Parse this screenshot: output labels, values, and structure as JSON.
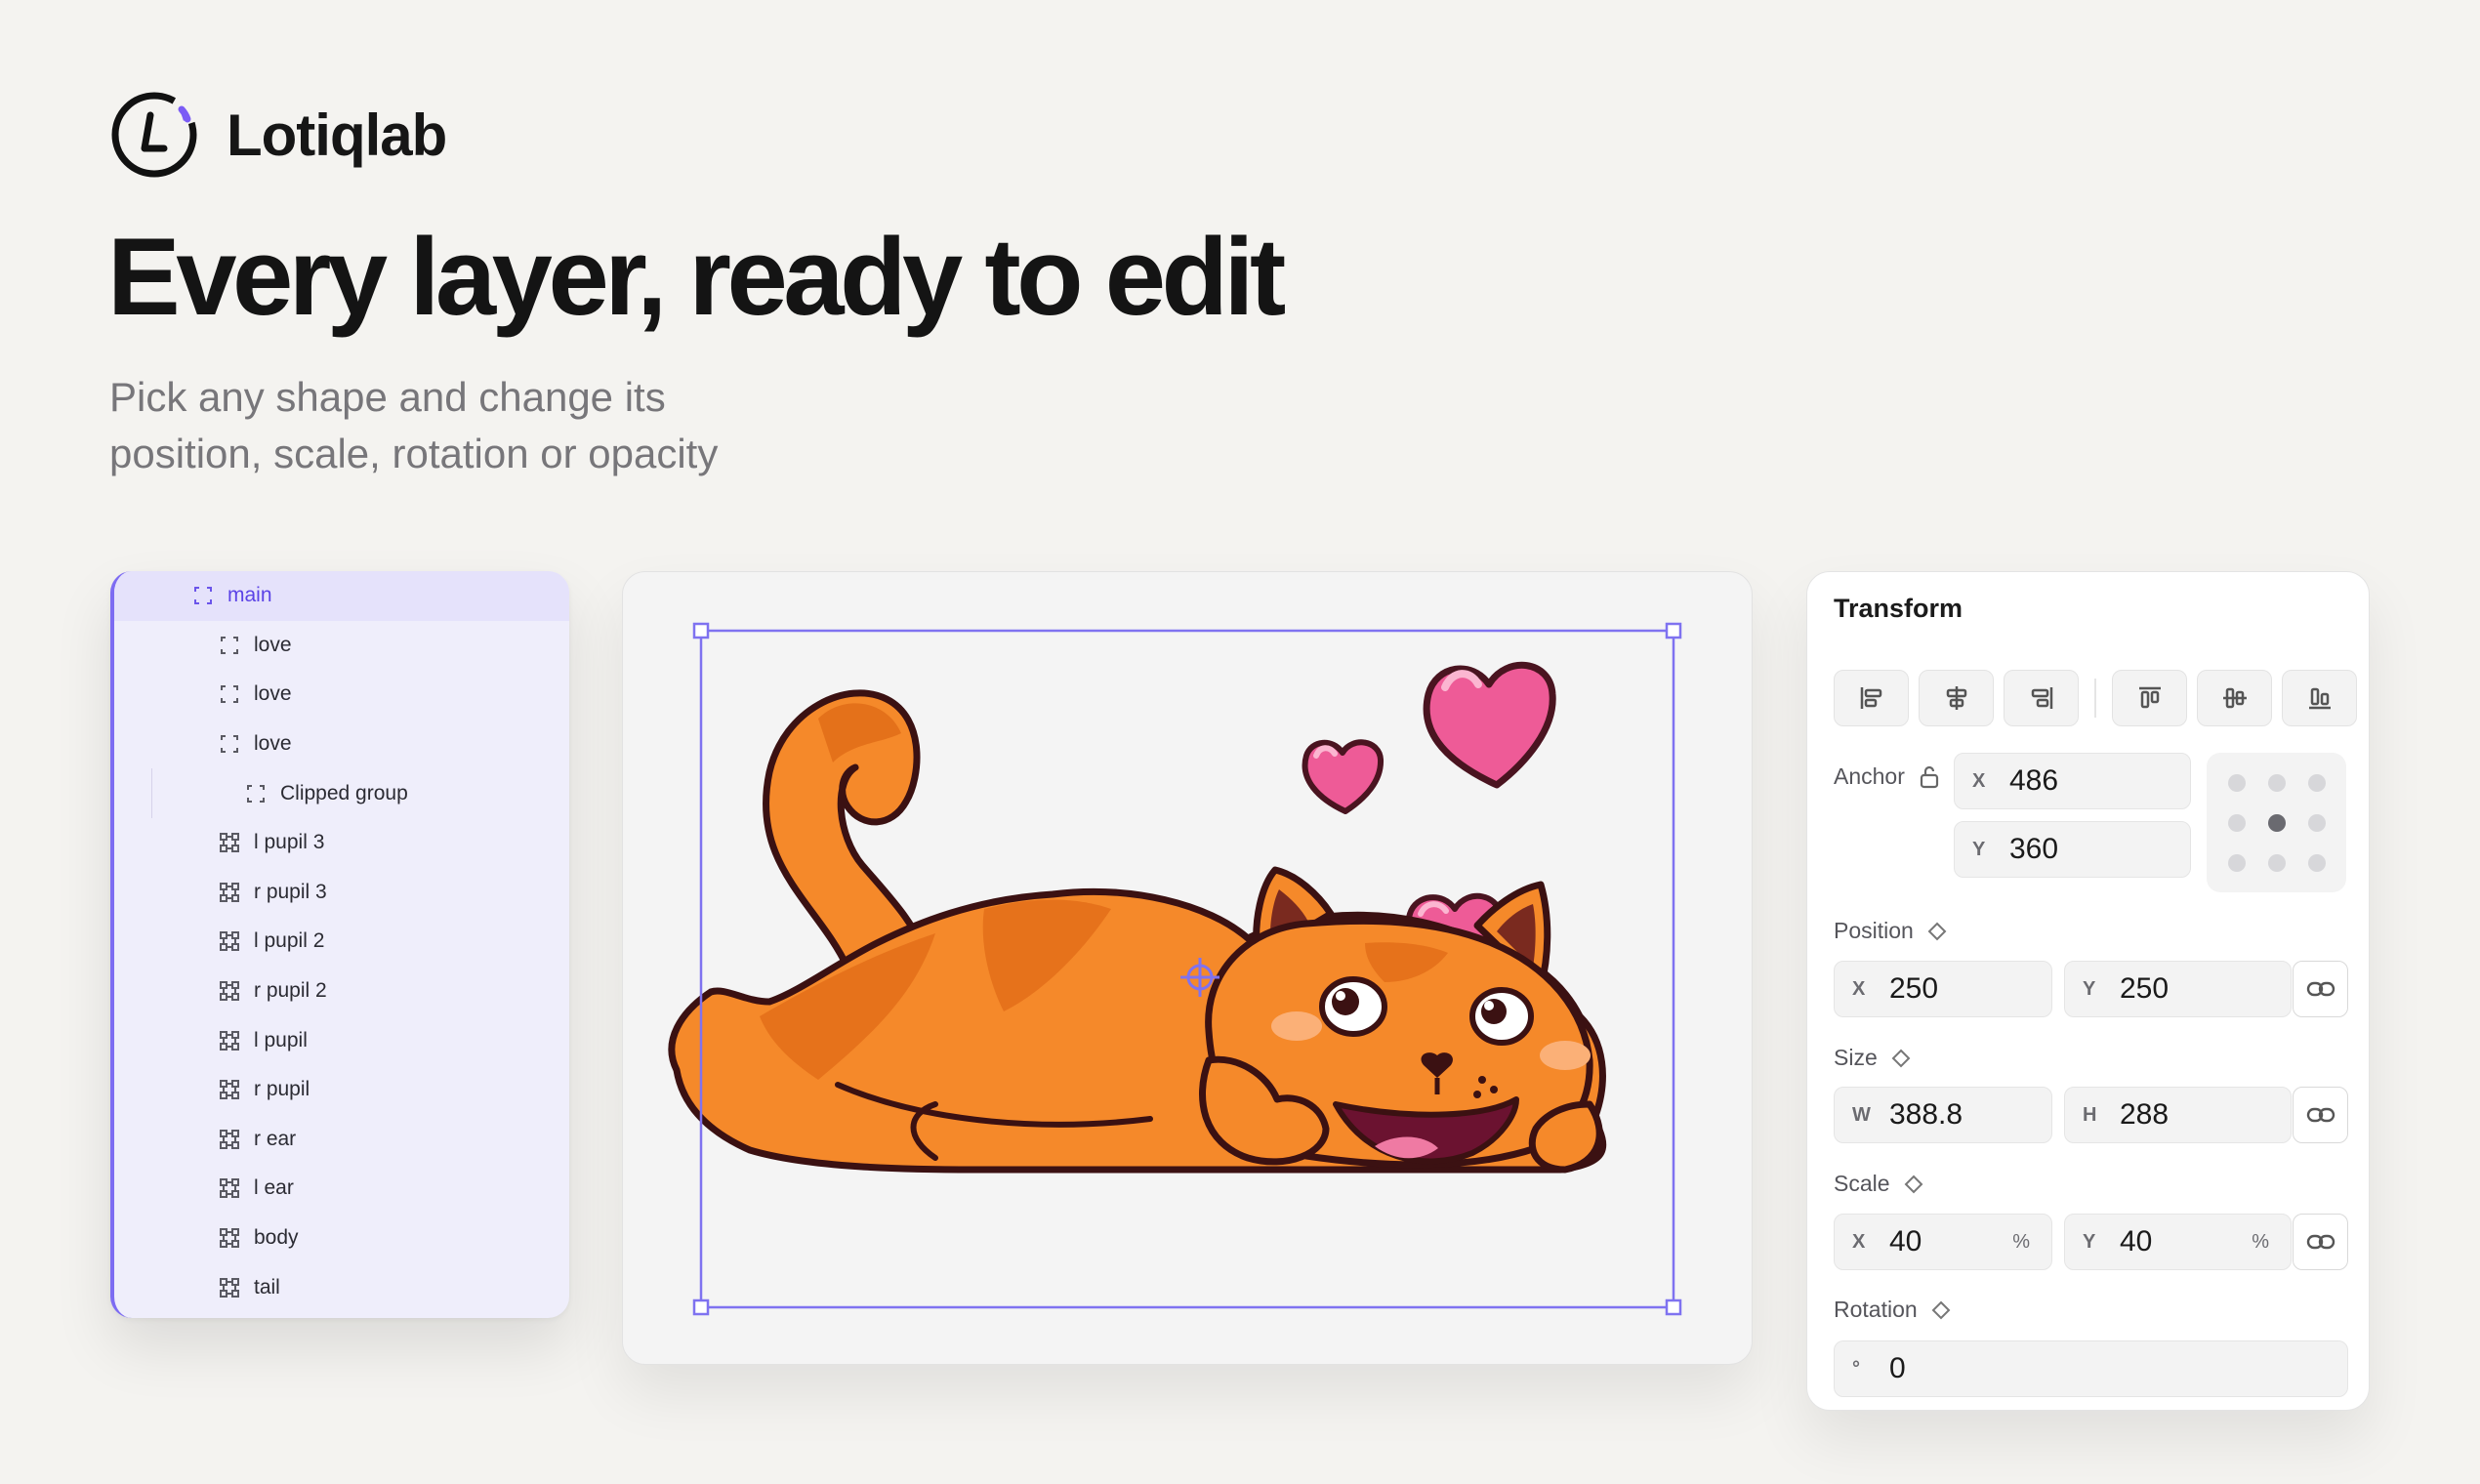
{
  "brand": {
    "name": "Lotiqlab",
    "logo_icon": "lotiqlab-logo-icon",
    "accent": "#7b5cf5"
  },
  "hero": {
    "headline": "Every layer, ready to edit",
    "sub_line1": "Pick any shape and change its",
    "sub_line2": "position, scale, rotation or opacity"
  },
  "layers": {
    "items": [
      {
        "label": "main",
        "icon": "group-icon",
        "depth": 1,
        "selected": true
      },
      {
        "label": "love",
        "icon": "group-icon",
        "depth": 2
      },
      {
        "label": "love",
        "icon": "group-icon",
        "depth": 2
      },
      {
        "label": "love",
        "icon": "group-icon",
        "depth": 2
      },
      {
        "label": "Clipped group",
        "icon": "group-icon",
        "depth": 3
      },
      {
        "label": "l pupil 3",
        "icon": "shape-icon",
        "depth": 2
      },
      {
        "label": "r pupil 3",
        "icon": "shape-icon",
        "depth": 2
      },
      {
        "label": "l pupil 2",
        "icon": "shape-icon",
        "depth": 2
      },
      {
        "label": "r pupil 2",
        "icon": "shape-icon",
        "depth": 2
      },
      {
        "label": "l pupil",
        "icon": "shape-icon",
        "depth": 2
      },
      {
        "label": "r pupil",
        "icon": "shape-icon",
        "depth": 2
      },
      {
        "label": "r ear",
        "icon": "shape-icon",
        "depth": 2
      },
      {
        "label": "l ear",
        "icon": "shape-icon",
        "depth": 2
      },
      {
        "label": "body",
        "icon": "shape-icon",
        "depth": 2
      },
      {
        "label": "tail",
        "icon": "shape-icon",
        "depth": 2
      }
    ]
  },
  "canvas": {
    "selection_color": "#7f72f0",
    "cat_color": "#f5892a",
    "heart_color": "#ef5c99"
  },
  "transform": {
    "title": "Transform",
    "align_icons": [
      "align-left-icon",
      "align-center-h-icon",
      "align-right-icon",
      "align-top-icon",
      "align-middle-v-icon",
      "align-bottom-icon"
    ],
    "anchor": {
      "label": "Anchor",
      "x_prefix": "X",
      "x": "486",
      "y_prefix": "Y",
      "y": "360",
      "lock_icon": "unlock-icon"
    },
    "position": {
      "label": "Position",
      "x_prefix": "X",
      "x": "250",
      "y_prefix": "Y",
      "y": "250"
    },
    "size": {
      "label": "Size",
      "w_prefix": "W",
      "w": "388.8",
      "h_prefix": "H",
      "h": "288"
    },
    "scale": {
      "label": "Scale",
      "x_prefix": "X",
      "x": "40",
      "x_unit": "%",
      "y_prefix": "Y",
      "y": "40",
      "y_unit": "%"
    },
    "rotation": {
      "label": "Rotation",
      "prefix": "°",
      "value": "0"
    },
    "keyframe_icon": "keyframe-diamond-icon",
    "link_icon": "link-icon"
  }
}
